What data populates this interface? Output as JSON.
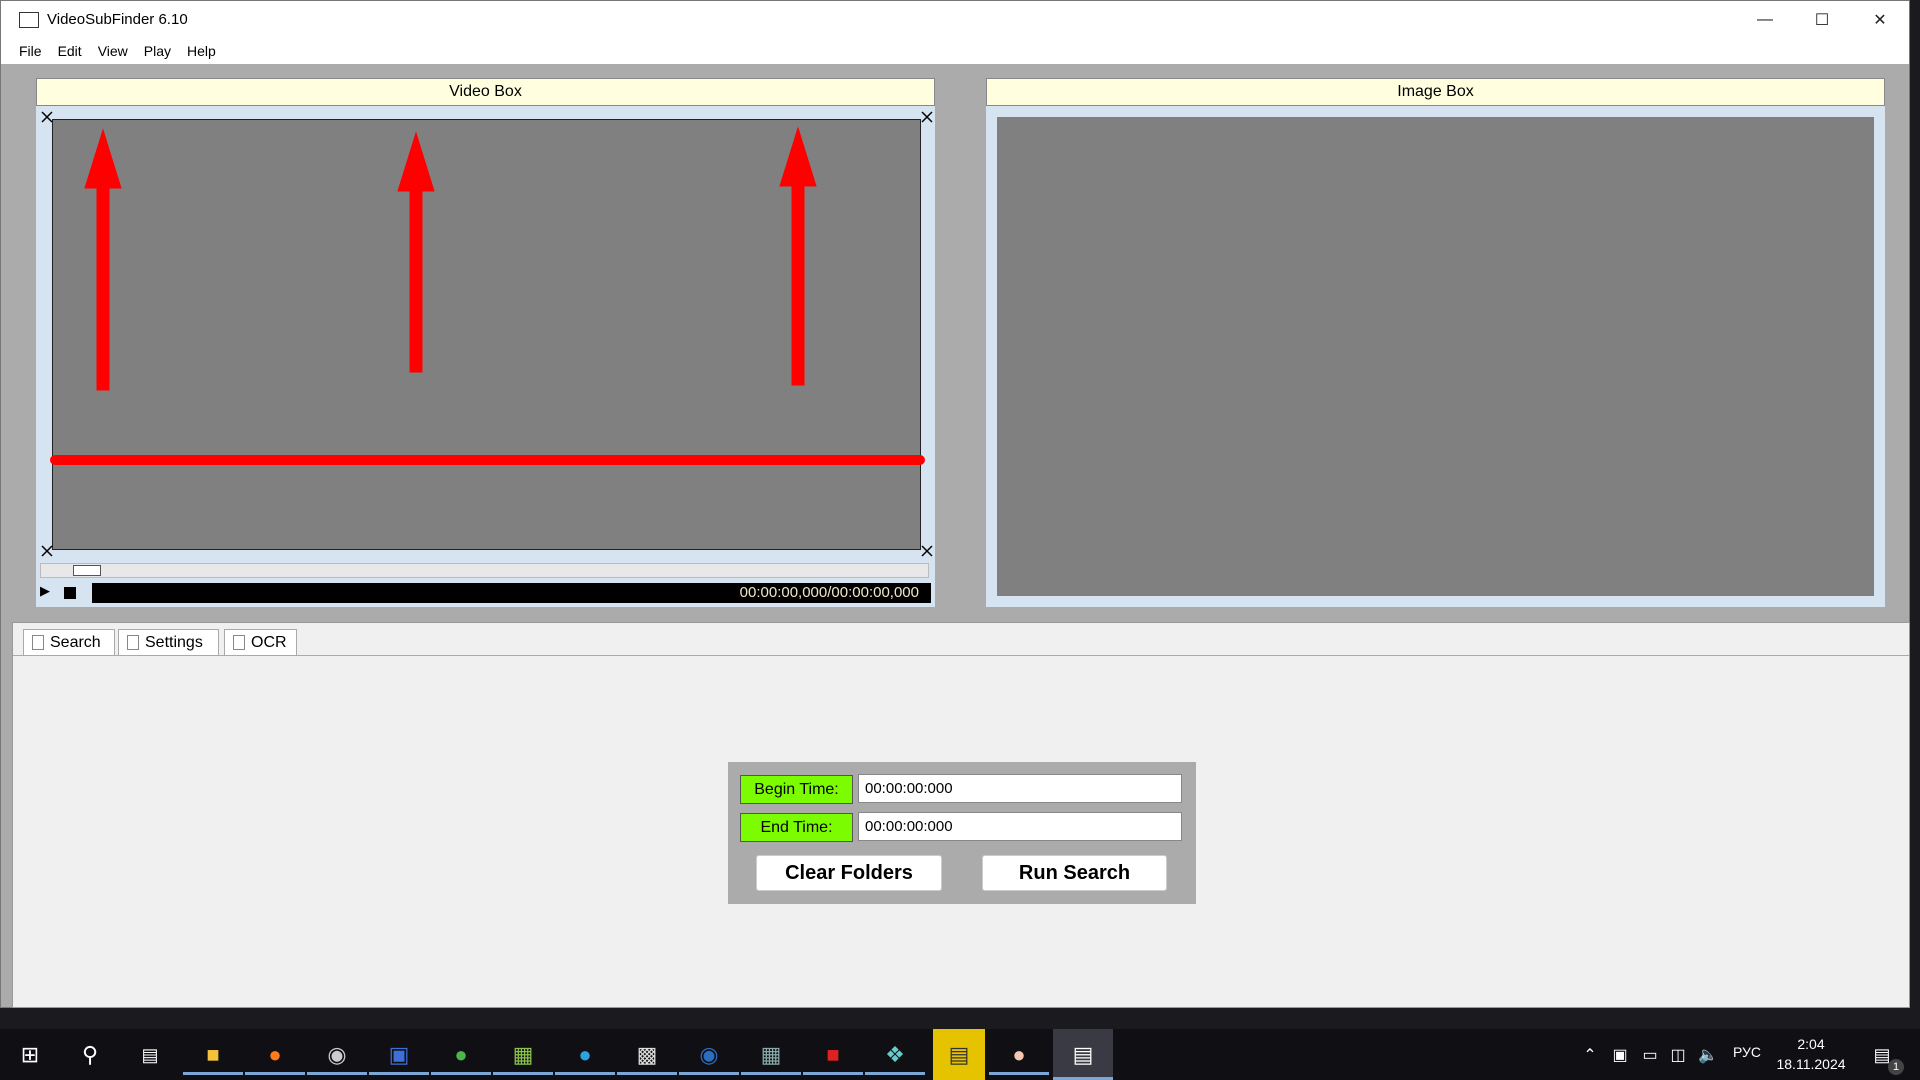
{
  "window": {
    "title": "VideoSubFinder 6.10",
    "controls": [
      "minimize",
      "maximize",
      "close"
    ]
  },
  "menu": [
    "File",
    "Edit",
    "View",
    "Play",
    "Help"
  ],
  "video_box": {
    "title": "Video Box",
    "time": "00:00:00,000/00:00:00,000"
  },
  "image_box": {
    "title": "Image Box"
  },
  "tabs": [
    {
      "label": "Search"
    },
    {
      "label": "Settings"
    },
    {
      "label": "OCR"
    }
  ],
  "search": {
    "begin_label": "Begin Time:",
    "begin_value": "00:00:00:000",
    "end_label": "End Time:",
    "end_value": "00:00:00:000",
    "clear_button": "Clear Folders",
    "run_button": "Run Search"
  },
  "taskbar": {
    "apps": [
      "file-explorer",
      "firefox",
      "obs",
      "app",
      "utorrent",
      "notepad",
      "telegram",
      "terminal",
      "steam",
      "calculator",
      "filezilla",
      "app",
      "app-active",
      "app",
      "videosubfinder"
    ],
    "language": "РУС",
    "time": "2:04",
    "date": "18.11.2024",
    "notifications": "1"
  },
  "colors": {
    "label_green": "#7cfc00",
    "header_yellow": "#ffffe0",
    "annotation_red": "#ff0000"
  }
}
